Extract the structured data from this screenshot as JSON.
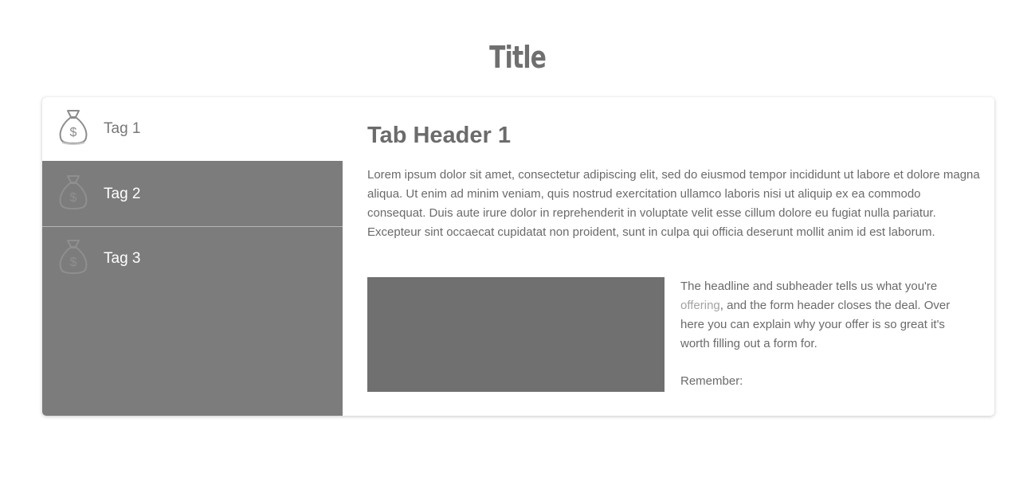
{
  "page": {
    "title": "Title"
  },
  "tabs": [
    {
      "label": "Tag 1",
      "icon": "money-bag-icon",
      "active": true
    },
    {
      "label": "Tag 2",
      "icon": "money-bag-icon",
      "active": false
    },
    {
      "label": "Tag 3",
      "icon": "money-bag-icon",
      "active": false
    }
  ],
  "panel": {
    "header": "Tab Header 1",
    "body": "Lorem ipsum dolor sit amet, consectetur adipiscing elit, sed do eiusmod tempor incididunt ut labore et dolore magna aliqua. Ut enim ad minim veniam, quis nostrud exercitation ullamco laboris nisi ut aliquip ex ea commodo consequat. Duis aute irure dolor in reprehenderit in voluptate velit esse cillum dolore eu fugiat nulla pariatur. Excepteur sint occaecat cupidatat non proident, sunt in culpa qui officia deserunt mollit anim id est laborum.",
    "side_text_before": "The headline and subheader tells us what you're ",
    "side_link": "offering",
    "side_text_after": ", and the form header closes the deal. Over here you can explain why your offer is so great it's worth filling out a form for.",
    "remember": "Remember:"
  },
  "colors": {
    "tab_background": "#7c7c7c",
    "active_tab_background": "#ffffff",
    "image_placeholder": "#707070",
    "link": "#a3a3a3",
    "text": "#6a6a6a"
  }
}
